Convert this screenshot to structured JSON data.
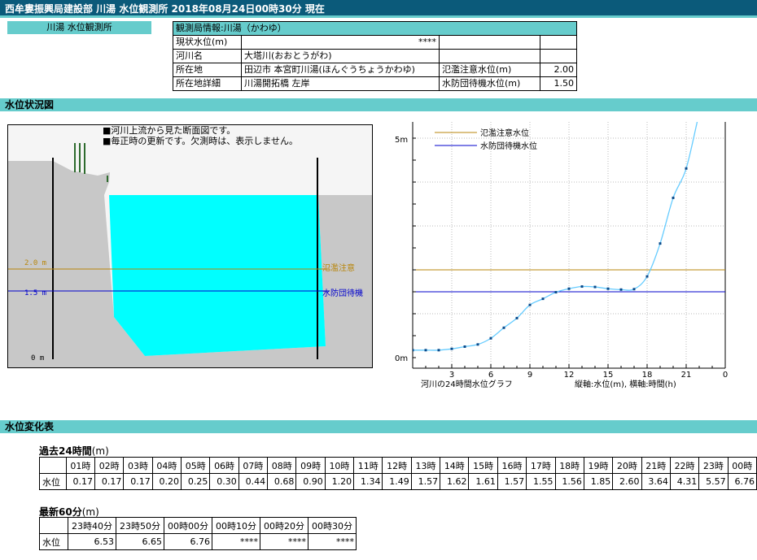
{
  "header": {
    "title": "西牟婁振興局建設部 川湯 水位観測所 2018年08月24日00時30分 現在"
  },
  "station": {
    "label": "川湯 水位観測所"
  },
  "info": {
    "heading": "観測局情報:川湯（かわゆ）",
    "current_label": "現状水位(m)",
    "current_value": "****",
    "river_label": "河川名",
    "river_value": "大塔川(おおとうがわ)",
    "location_label": "所在地",
    "location_value": "田辺市 本宮町川湯(ほんぐうちょうかわゆ)",
    "flood_label": "氾濫注意水位(m)",
    "flood_value": "2.00",
    "detail_label": "所在地詳細",
    "detail_value": "川湯開拓橋 左岸",
    "standby_label": "水防団待機水位(m)",
    "standby_value": "1.50"
  },
  "sections": {
    "status": "水位状況図",
    "table": "水位変化表"
  },
  "cross_section": {
    "note1": "■河川上流から見た断面図です。",
    "note2": "■毎正時の更新です。欠測時は、表示しません。",
    "lvl_flood": "2.0 m",
    "lvl_standby": "1.5 m",
    "lvl_zero": "0 m",
    "flood_tag": "氾濫注意",
    "standby_tag": "水防団待機",
    "water_level": 6.76,
    "flood_level": 2.0,
    "standby_level": 1.5,
    "colors": {
      "water": "#00ffff",
      "ground": "#c8c8c8",
      "flood": "#b8860b",
      "standby": "#0000cc"
    }
  },
  "chart_data": {
    "type": "line",
    "x": [
      1,
      2,
      3,
      4,
      5,
      6,
      7,
      8,
      9,
      10,
      11,
      12,
      13,
      14,
      15,
      16,
      17,
      18,
      19,
      20,
      21,
      22,
      23,
      24
    ],
    "values": [
      0.17,
      0.17,
      0.17,
      0.2,
      0.25,
      0.3,
      0.44,
      0.68,
      0.9,
      1.2,
      1.34,
      1.49,
      1.57,
      1.62,
      1.61,
      1.57,
      1.55,
      1.56,
      1.85,
      2.6,
      3.64,
      4.31,
      5.57,
      6.76
    ],
    "xticks": [
      "3",
      "6",
      "9",
      "12",
      "15",
      "18",
      "21",
      "0"
    ],
    "yticks": [
      "5m",
      "0m"
    ],
    "ylim": [
      0,
      5
    ],
    "legend": [
      {
        "label": "氾濫注意水位",
        "color": "#b8860b",
        "value": 2.0
      },
      {
        "label": "水防団待機水位",
        "color": "#0000cc",
        "value": 1.5
      }
    ],
    "caption_left": "河川の24時間水位グラフ",
    "caption_right": "縦軸:水位(m), 横軸:時間(h)",
    "line_color": "#66ccff"
  },
  "past24": {
    "title": "過去24時間",
    "unit": "(m)",
    "row_label": "水位",
    "hours": [
      "01時",
      "02時",
      "03時",
      "04時",
      "05時",
      "06時",
      "07時",
      "08時",
      "09時",
      "10時",
      "11時",
      "12時",
      "13時",
      "14時",
      "15時",
      "16時",
      "17時",
      "18時",
      "19時",
      "20時",
      "21時",
      "22時",
      "23時",
      "00時"
    ],
    "values": [
      "0.17",
      "0.17",
      "0.17",
      "0.20",
      "0.25",
      "0.30",
      "0.44",
      "0.68",
      "0.90",
      "1.20",
      "1.34",
      "1.49",
      "1.57",
      "1.62",
      "1.61",
      "1.57",
      "1.55",
      "1.56",
      "1.85",
      "2.60",
      "3.64",
      "4.31",
      "5.57",
      "6.76"
    ]
  },
  "latest60": {
    "title": "最新60分",
    "unit": "(m)",
    "row_label": "水位",
    "times": [
      "23時40分",
      "23時50分",
      "00時00分",
      "00時10分",
      "00時20分",
      "00時30分"
    ],
    "values": [
      "6.53",
      "6.65",
      "6.76",
      "****",
      "****",
      "****"
    ]
  }
}
